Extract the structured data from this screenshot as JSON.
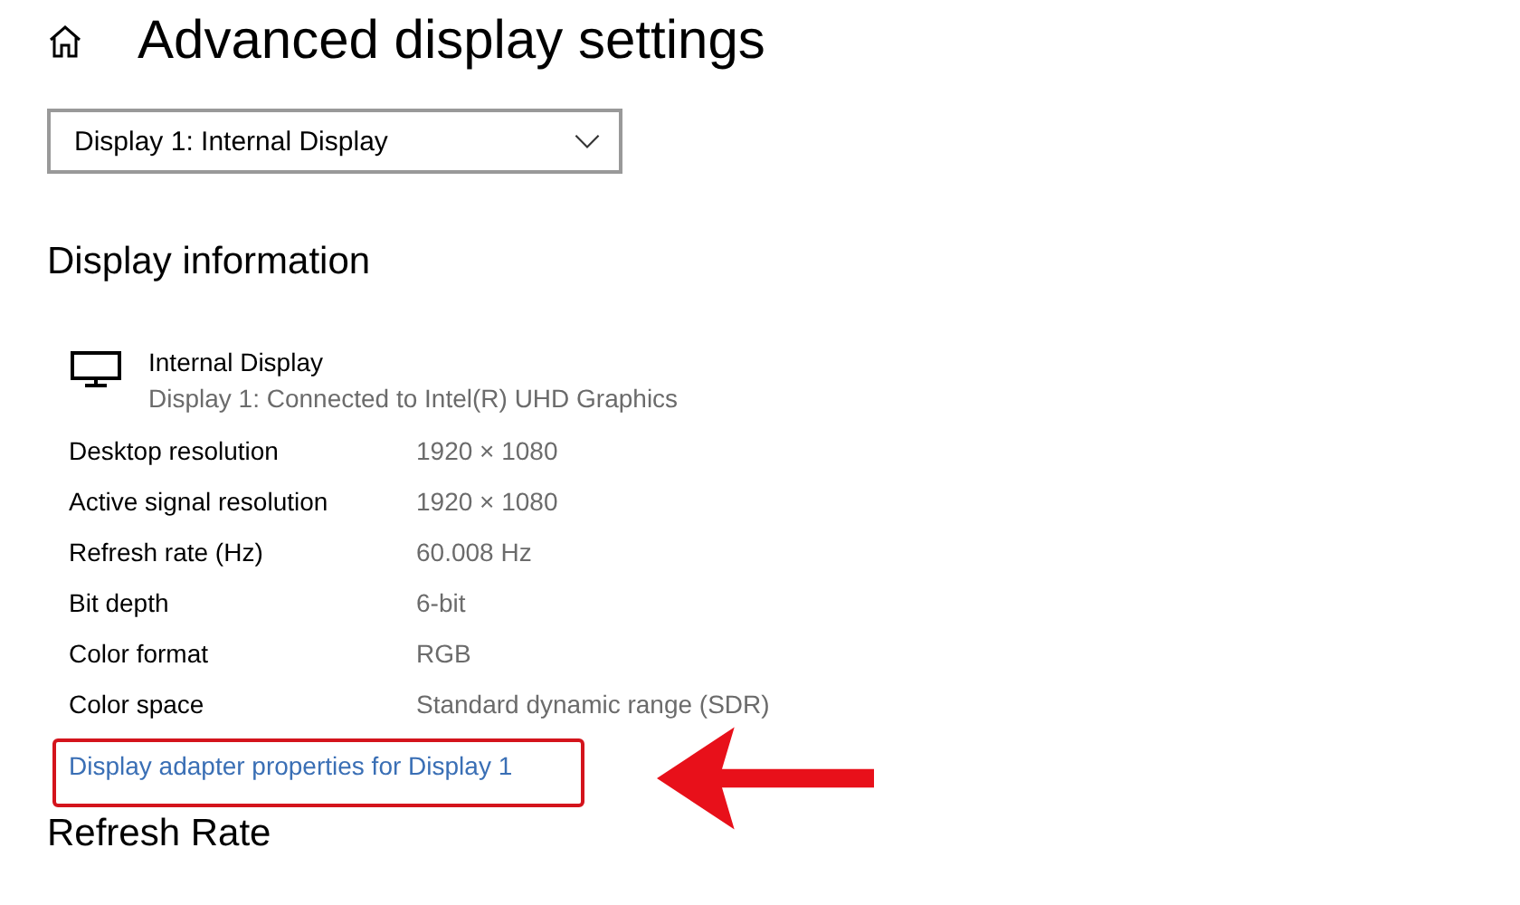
{
  "header": {
    "title": "Advanced display settings"
  },
  "display_select": {
    "value": "Display 1: Internal Display"
  },
  "display_information": {
    "heading": "Display information",
    "monitor_name": "Internal Display",
    "monitor_detail": "Display 1: Connected to Intel(R) UHD Graphics",
    "rows": [
      {
        "label": "Desktop resolution",
        "value": "1920 × 1080"
      },
      {
        "label": "Active signal resolution",
        "value": "1920 × 1080"
      },
      {
        "label": "Refresh rate (Hz)",
        "value": "60.008 Hz"
      },
      {
        "label": "Bit depth",
        "value": "6-bit"
      },
      {
        "label": "Color format",
        "value": "RGB"
      },
      {
        "label": "Color space",
        "value": "Standard dynamic range (SDR)"
      }
    ],
    "link": "Display adapter properties for Display 1"
  },
  "refresh_rate": {
    "heading": "Refresh Rate"
  }
}
